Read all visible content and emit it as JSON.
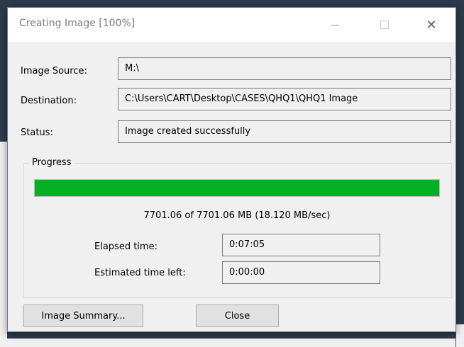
{
  "window": {
    "title": "Creating Image [100%]"
  },
  "fields": {
    "image_source": {
      "label": "Image Source:",
      "value": "M:\\"
    },
    "destination": {
      "label": "Destination:",
      "value": "C:\\Users\\CART\\Desktop\\CASES\\QHQ1\\QHQ1 Image"
    },
    "status": {
      "label": "Status:",
      "value": "Image created successfully"
    }
  },
  "progress": {
    "legend": "Progress",
    "percent": 100,
    "summary": "7701.06 of 7701.06 MB (18.120 MB/sec)",
    "elapsed_label": "Elapsed time:",
    "elapsed_value": "0:07:05",
    "remaining_label": "Estimated time left:",
    "remaining_value": "0:00:00",
    "bar_color": "#06b025"
  },
  "buttons": {
    "image_summary": "Image Summary...",
    "close": "Close"
  },
  "icons": {
    "minimize": "minimize-icon",
    "maximize": "maximize-icon",
    "close": "close-icon"
  }
}
